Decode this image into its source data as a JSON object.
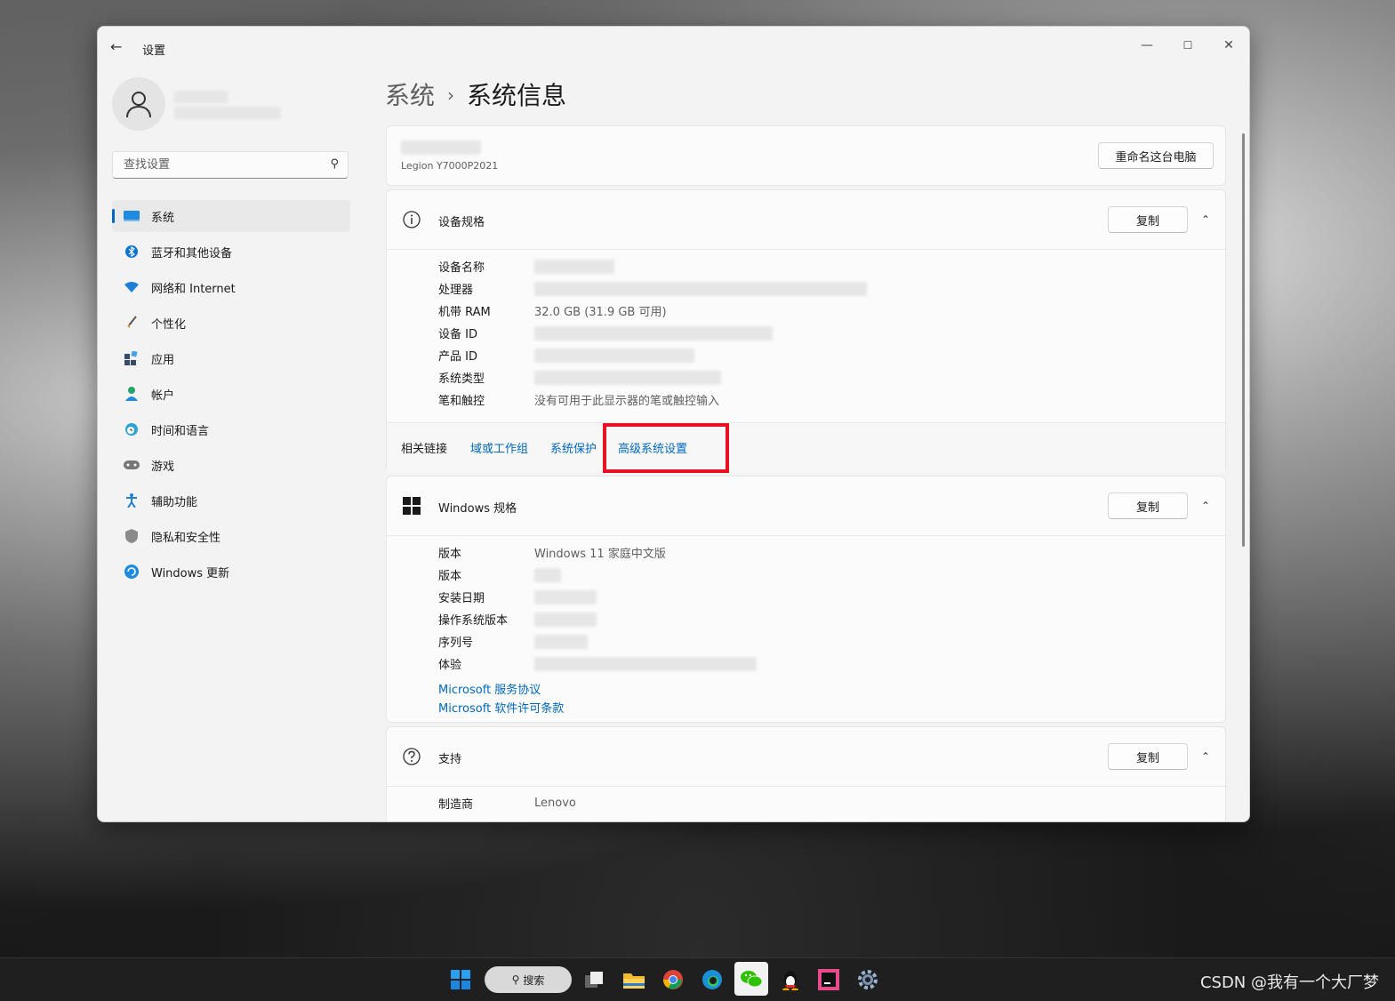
{
  "window": {
    "title": "设置",
    "back": "←",
    "minimize": "—",
    "maximize": "☐",
    "close": "✕"
  },
  "sidebar": {
    "search_placeholder": "查找设置",
    "items": [
      {
        "label": "系统",
        "icon": "display-icon",
        "active": true
      },
      {
        "label": "蓝牙和其他设备",
        "icon": "bluetooth-icon"
      },
      {
        "label": "网络和 Internet",
        "icon": "wifi-icon"
      },
      {
        "label": "个性化",
        "icon": "brush-icon"
      },
      {
        "label": "应用",
        "icon": "apps-icon"
      },
      {
        "label": "帐户",
        "icon": "account-icon"
      },
      {
        "label": "时间和语言",
        "icon": "clock-globe-icon"
      },
      {
        "label": "游戏",
        "icon": "gamepad-icon"
      },
      {
        "label": "辅助功能",
        "icon": "accessibility-icon"
      },
      {
        "label": "隐私和安全性",
        "icon": "shield-icon"
      },
      {
        "label": "Windows 更新",
        "icon": "update-icon"
      }
    ]
  },
  "breadcrumb": {
    "parent": "系统",
    "separator": "›",
    "current": "系统信息"
  },
  "device_header": {
    "model": "Legion Y7000P2021",
    "rename_button": "重命名这台电脑"
  },
  "device_specs": {
    "title": "设备规格",
    "copy": "复制",
    "rows": [
      {
        "key": "设备名称",
        "value": ""
      },
      {
        "key": "处理器",
        "value": ""
      },
      {
        "key": "机带 RAM",
        "value": "32.0 GB (31.9 GB 可用)"
      },
      {
        "key": "设备 ID",
        "value": ""
      },
      {
        "key": "产品 ID",
        "value": ""
      },
      {
        "key": "系统类型",
        "value": ""
      },
      {
        "key": "笔和触控",
        "value": "没有可用于此显示器的笔或触控输入"
      }
    ],
    "related_label": "相关链接",
    "related_links": [
      "域或工作组",
      "系统保护",
      "高级系统设置"
    ]
  },
  "windows_specs": {
    "title": "Windows 规格",
    "copy": "复制",
    "rows": [
      {
        "key": "版本",
        "value": "Windows 11 家庭中文版"
      },
      {
        "key": "版本",
        "value": ""
      },
      {
        "key": "安装日期",
        "value": ""
      },
      {
        "key": "操作系统版本",
        "value": ""
      },
      {
        "key": "序列号",
        "value": ""
      },
      {
        "key": "体验",
        "value": ""
      }
    ],
    "links": [
      "Microsoft 服务协议",
      "Microsoft 软件许可条款"
    ]
  },
  "support": {
    "title": "支持",
    "copy": "复制",
    "rows": [
      {
        "key": "制造商",
        "value": "Lenovo"
      }
    ]
  },
  "taskbar": {
    "search_label": "搜索"
  },
  "watermark": "CSDN @我有一个大厂梦",
  "colors": {
    "accent": "#0067c0",
    "highlight": "#e81123"
  }
}
